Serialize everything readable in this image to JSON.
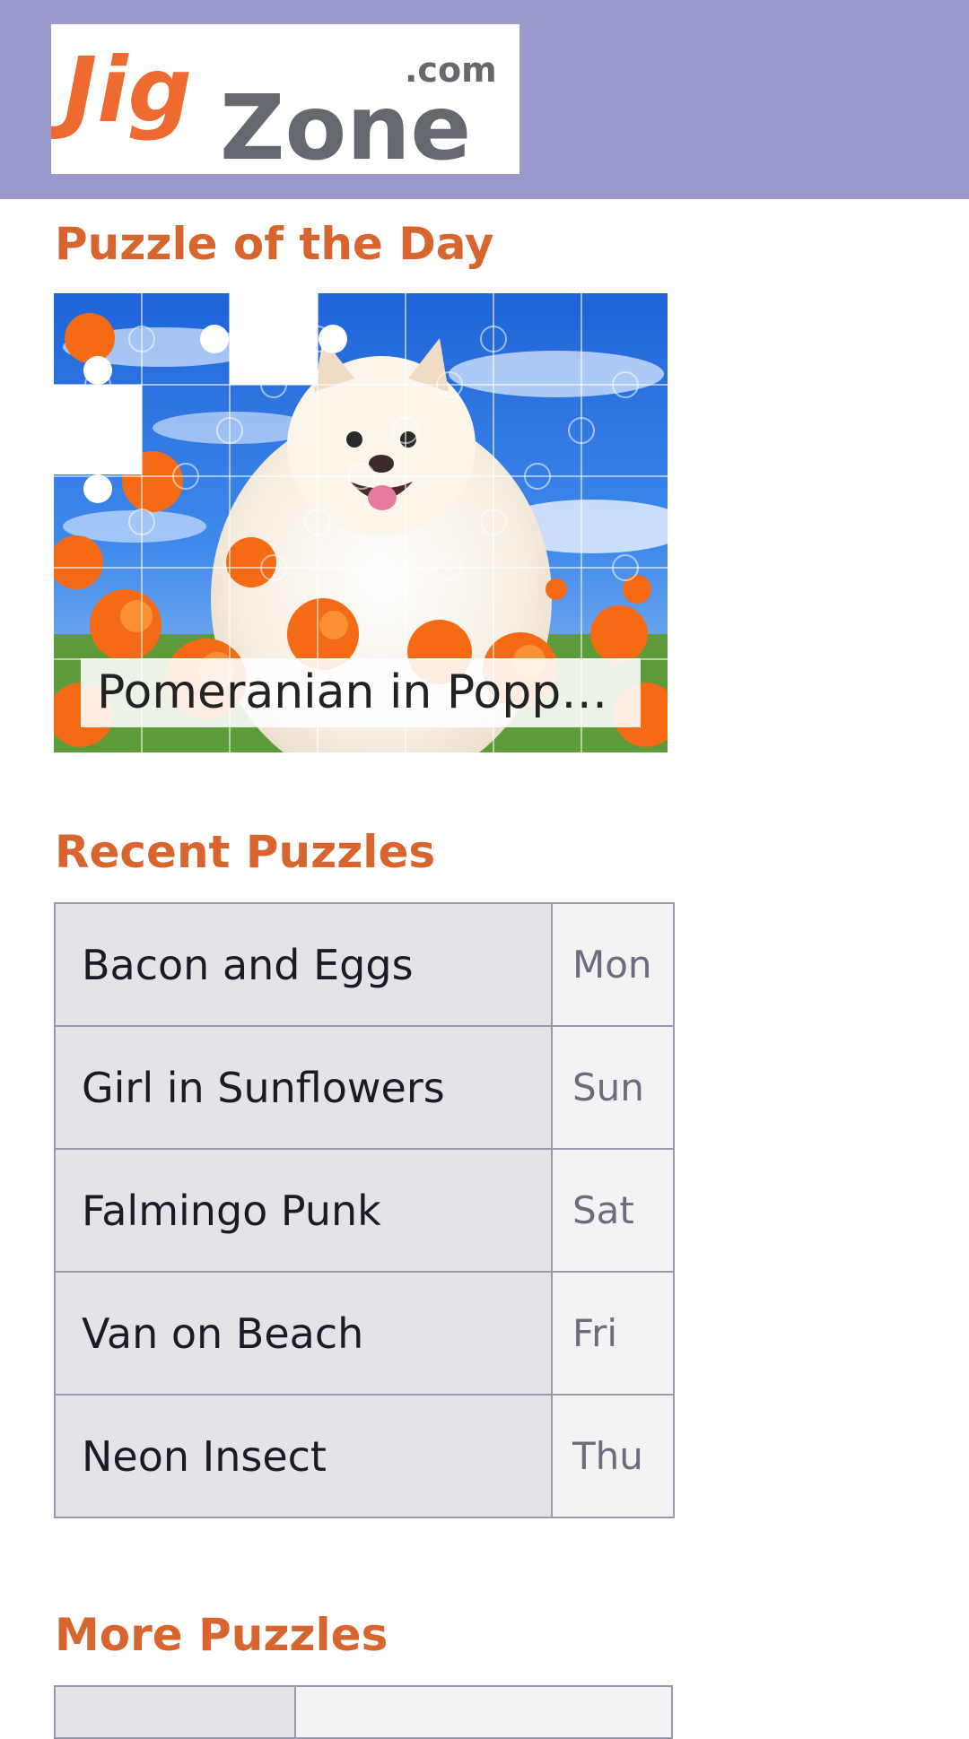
{
  "header": {
    "logo": {
      "part1": "Jig",
      "part2": "Zone",
      "suffix": ".com"
    },
    "brand_color": "#9b9bcb"
  },
  "puzzle_of_day": {
    "title": "Puzzle of the Day",
    "caption": "Pomeranian in Popp…"
  },
  "recent": {
    "title": "Recent Puzzles",
    "rows": [
      {
        "name": "Bacon and Eggs",
        "day": "Mon"
      },
      {
        "name": "Girl in Sunflowers",
        "day": "Sun"
      },
      {
        "name": "Falmingo Punk",
        "day": "Sat"
      },
      {
        "name": "Van on Beach",
        "day": "Fri"
      },
      {
        "name": "Neon Insect",
        "day": "Thu"
      }
    ]
  },
  "more": {
    "title": "More Puzzles"
  },
  "colors": {
    "heading": "#d7652d",
    "logo_orange": "#ee6a30",
    "logo_gray": "#646970"
  }
}
